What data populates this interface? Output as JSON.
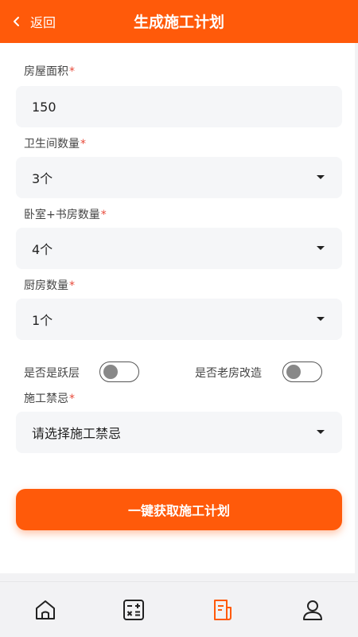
{
  "header": {
    "back_label": "返回",
    "title": "生成施工计划"
  },
  "form": {
    "area": {
      "label": "房屋面积",
      "required_mark": "*",
      "value": "150"
    },
    "bathrooms": {
      "label": "卫生间数量",
      "required_mark": "*",
      "value": "3个"
    },
    "bedrooms": {
      "label": "卧室+书房数量",
      "required_mark": "*",
      "value": "4个"
    },
    "kitchens": {
      "label": "厨房数量",
      "required_mark": "*",
      "value": "1个"
    },
    "duplex": {
      "label": "是否是跃层",
      "on": false
    },
    "old_house": {
      "label": "是否老房改造",
      "on": false
    },
    "taboo": {
      "label": "施工禁忌",
      "required_mark": "*",
      "placeholder": "请选择施工禁忌"
    },
    "submit_label": "一键获取施工计划"
  },
  "tabbar": {
    "active_index": 2,
    "items": [
      {
        "icon": "home-icon"
      },
      {
        "icon": "calculator-icon"
      },
      {
        "icon": "plan-document-icon"
      },
      {
        "icon": "profile-icon"
      }
    ]
  },
  "colors": {
    "accent": "#ff5a0a",
    "required": "#e84a3a",
    "field_bg": "#f5f6f8"
  }
}
